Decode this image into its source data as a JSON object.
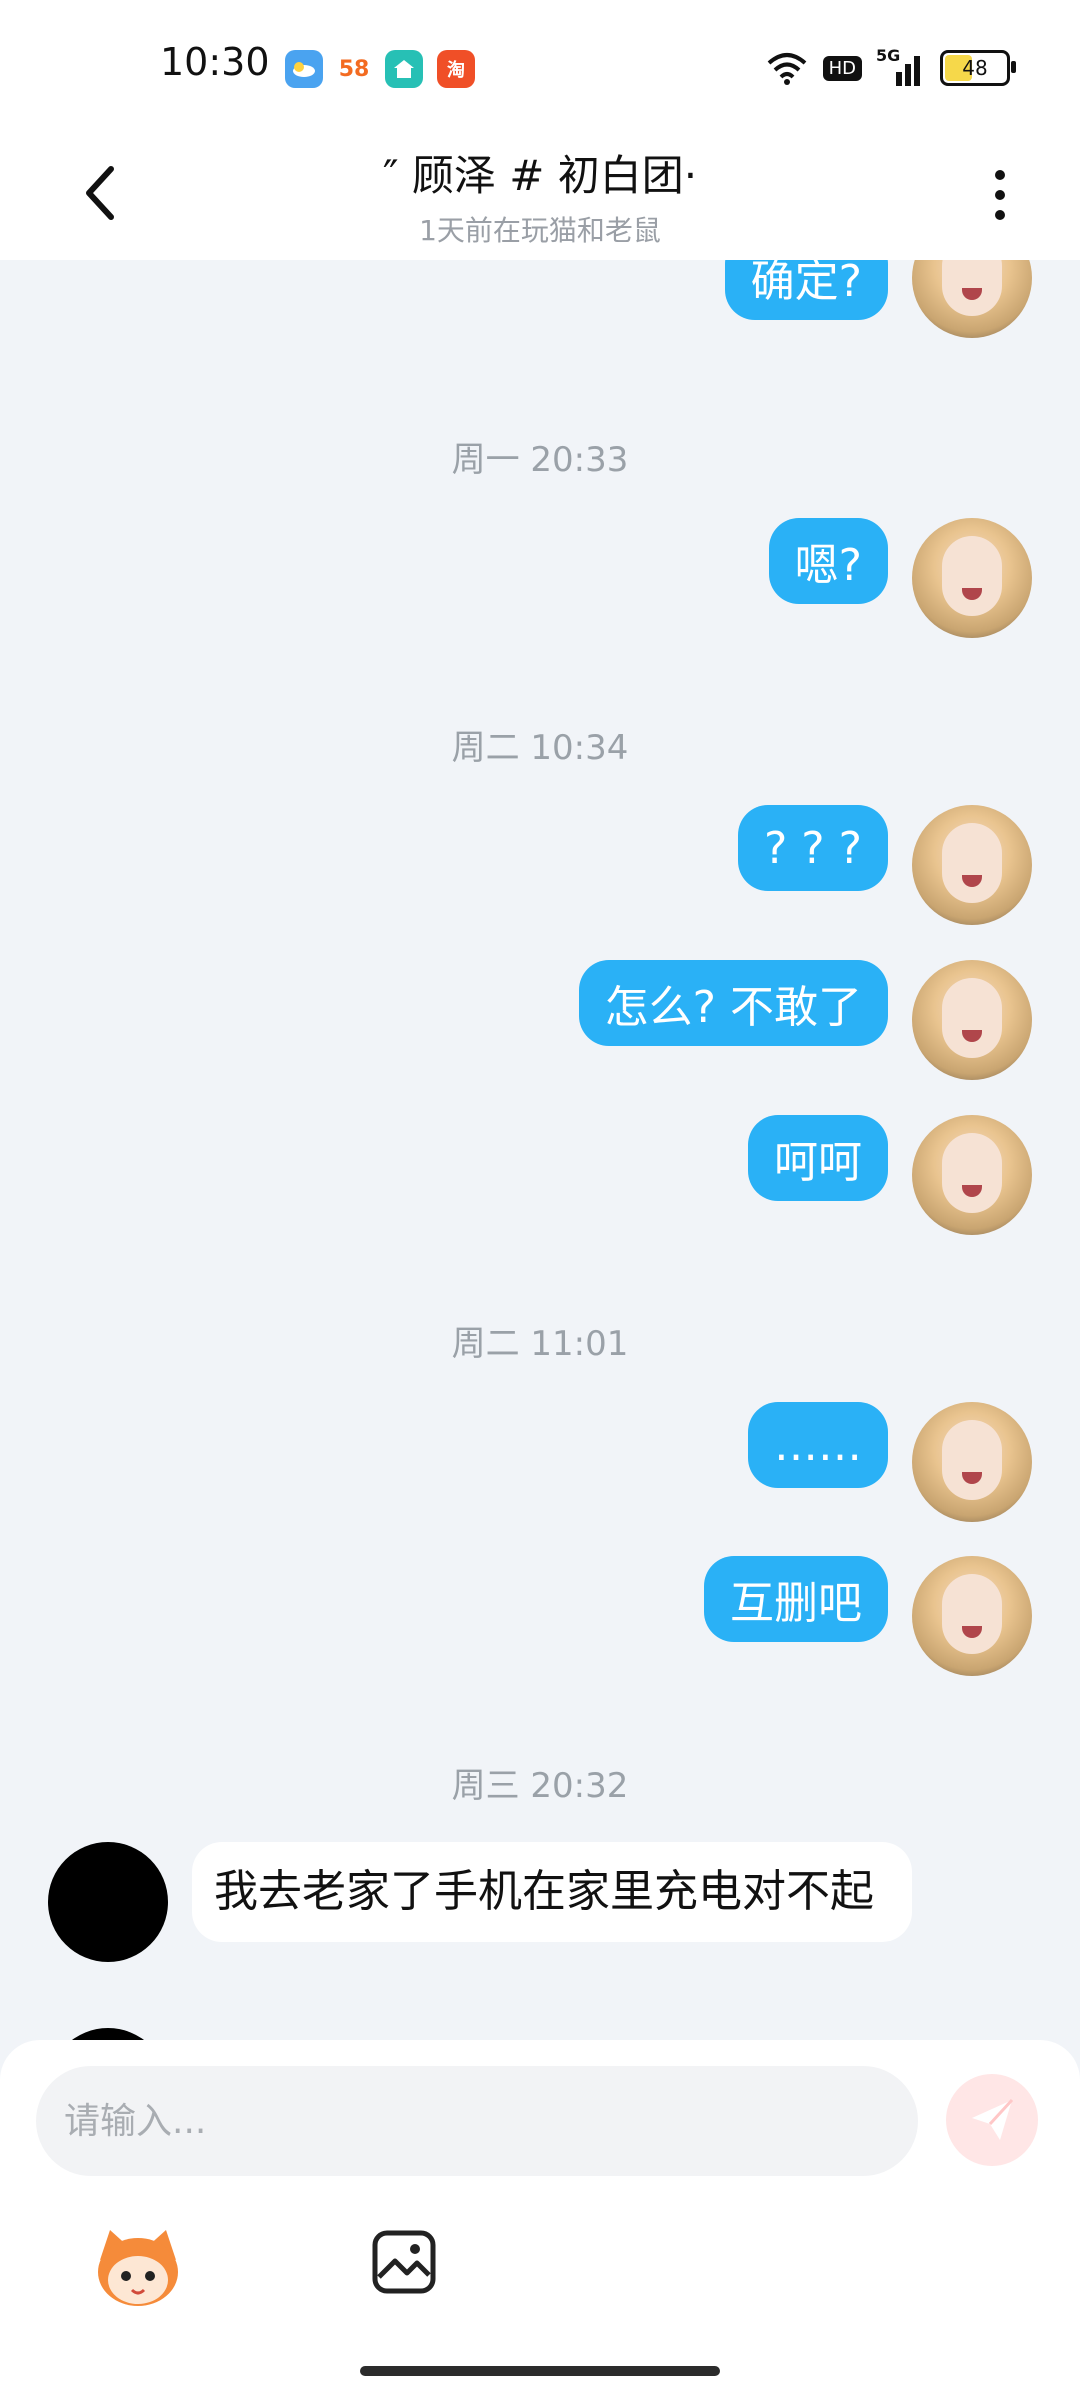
{
  "status_bar": {
    "time": "10:30",
    "app_icons": [
      {
        "name": "weather-icon",
        "color": "#4AA3F0",
        "text": ""
      },
      {
        "name": "58-app-icon",
        "color": "#FFFFFF",
        "text": "58"
      },
      {
        "name": "home-app-icon",
        "color": "#27C0B5",
        "text": ""
      },
      {
        "name": "taobao-icon",
        "color": "#F04F27",
        "text": "淘"
      }
    ],
    "signal": "5G",
    "hd": "HD",
    "battery": "48",
    "battery_level": 0.48
  },
  "header": {
    "title": "″ 顾泽 # 初白团·",
    "subtitle": "1天前在玩猫和老鼠"
  },
  "messages": [
    {
      "type": "outgoing",
      "text": "确定?"
    },
    {
      "type": "timestamp",
      "text": "周一 20:33"
    },
    {
      "type": "outgoing",
      "text": "嗯?"
    },
    {
      "type": "timestamp",
      "text": "周二 10:34"
    },
    {
      "type": "outgoing",
      "text": "? ? ?"
    },
    {
      "type": "outgoing",
      "text": "怎么? 不敢了"
    },
    {
      "type": "outgoing",
      "text": "呵呵"
    },
    {
      "type": "timestamp",
      "text": "周二 11:01"
    },
    {
      "type": "outgoing",
      "text": "……"
    },
    {
      "type": "outgoing",
      "text": "互删吧"
    },
    {
      "type": "timestamp",
      "text": "周三 20:32"
    },
    {
      "type": "incoming",
      "text": "我去老家了手机在家里充电对不起"
    }
  ],
  "input": {
    "placeholder": "请输入..."
  },
  "colors": {
    "accent": "#2AB1F6",
    "background": "#F1F4F8",
    "send_button_bg": "#FFE6E6"
  }
}
